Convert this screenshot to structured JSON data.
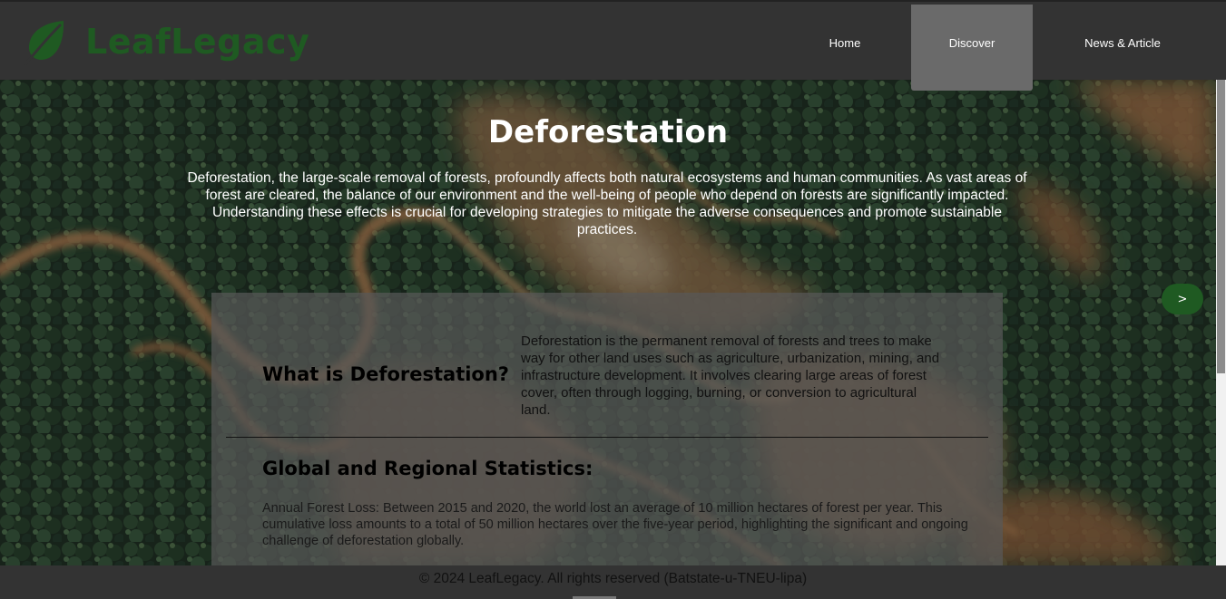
{
  "brand": {
    "name": "LeafLegacy",
    "color": "#1f5a22"
  },
  "nav": {
    "items": [
      {
        "label": "Home",
        "active": false
      },
      {
        "label": "Discover",
        "active": true
      },
      {
        "label": "News & Article",
        "active": false
      }
    ]
  },
  "hero": {
    "title": "Deforestation",
    "intro": "Deforestation, the large-scale removal of forests, profoundly affects both natural ecosystems and human communities. As vast areas of forest are cleared, the balance of our environment and the well-being of people who depend on forests are significantly impacted. Understanding these effects is crucial for developing strategies to mitigate the adverse consequences and promote sustainable practices."
  },
  "card": {
    "what": {
      "heading": "What is Deforestation?",
      "text": "Deforestation is the permanent removal of forests and trees to make way for other land uses such as agriculture, urbanization, mining, and infrastructure development. It involves clearing large areas of forest cover, often through logging, burning, or conversion to agricultural land."
    },
    "stats": {
      "heading": "Global and Regional Statistics:",
      "text": "Annual Forest Loss: Between 2015 and 2020, the world lost an average of 10 million hectares of forest per year. This cumulative loss amounts to a total of 50 million hectares over the five-year period, highlighting the significant and ongoing challenge of deforestation globally."
    }
  },
  "carousel": {
    "next_label": ">"
  },
  "footer": {
    "text": "© 2024 LeafLegacy. All rights reserved (Batstate-u-TNEU-lipa)"
  },
  "icons": {
    "logo": "leaf-icon",
    "next": "chevron-right-icon"
  }
}
